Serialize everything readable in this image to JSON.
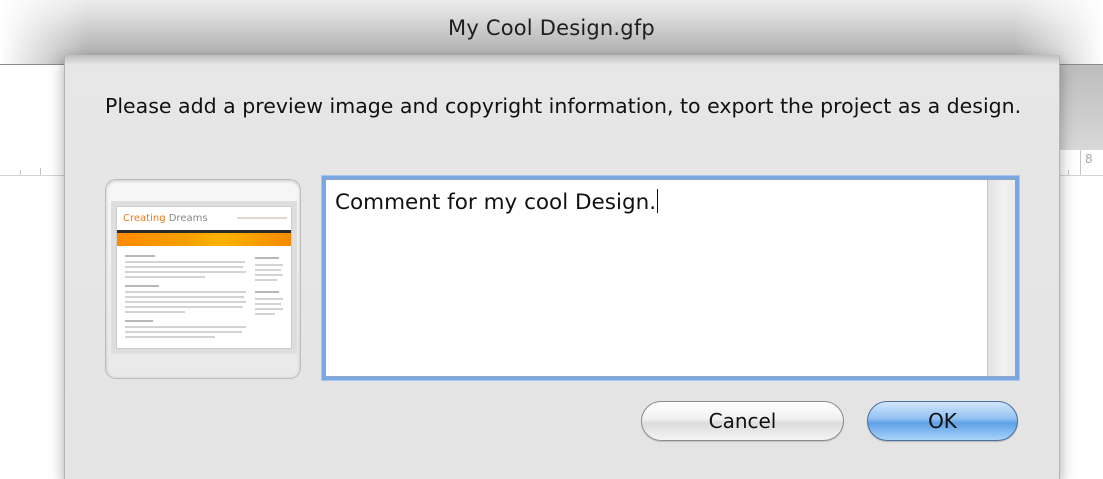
{
  "window": {
    "title": "My Cool Design.gfp"
  },
  "ruler": {
    "number": "8"
  },
  "dialog": {
    "message": "Please add a preview image and copyright information, to export the project as a design.",
    "preview": {
      "logo_highlight": "Creating",
      "logo_rest": " Dreams"
    },
    "comment": {
      "value": "Comment for my cool Design."
    },
    "buttons": {
      "cancel": "Cancel",
      "ok": "OK"
    }
  },
  "colors": {
    "accent_focus": "#7ba7e1",
    "default_button": "#5ea0e6",
    "thumbnail_brand": "#f07a12"
  }
}
